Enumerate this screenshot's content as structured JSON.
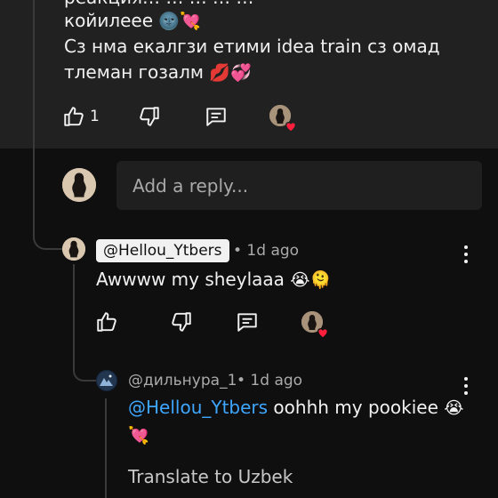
{
  "top_comment": {
    "line0": "реакция… … … … …",
    "line1_text": "койилеее",
    "line1_emoji": "🌚💘",
    "line2": "Сз нма екалгзи етими idea train сз омад",
    "line3_text": "тлеман гозалм",
    "line3_emoji": "💋💞",
    "like_count": "1"
  },
  "reply_input": {
    "placeholder": "Add a reply..."
  },
  "reply1": {
    "author": "@Hellou_Ytbers",
    "meta": "• 1d ago",
    "body_text": "Awwww my sheylaaa",
    "body_emoji": "😭🫠"
  },
  "reply2": {
    "author": "@дильнура_1",
    "meta": "• 1d ago",
    "mention": "@Hellou_Ytbers",
    "body_text": " oohhh my pookiee",
    "body_emoji1": "😭",
    "body_emoji2": "💘",
    "translate_label": "Translate to Uzbek"
  },
  "colors": {
    "background": "#0f0f0f",
    "card": "#212121",
    "link": "#3ea6ff",
    "heart": "#ff1f3d"
  }
}
